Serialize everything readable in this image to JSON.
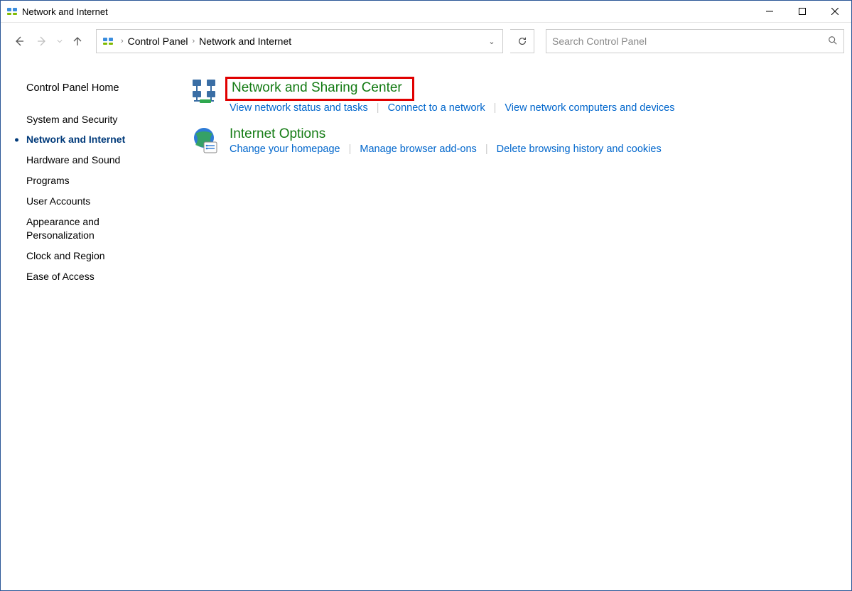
{
  "window": {
    "title": "Network and Internet"
  },
  "breadcrumb": {
    "root": "Control Panel",
    "current": "Network and Internet"
  },
  "search": {
    "placeholder": "Search Control Panel"
  },
  "sidebar": {
    "home": "Control Panel Home",
    "items": [
      {
        "label": "System and Security",
        "active": false
      },
      {
        "label": "Network and Internet",
        "active": true
      },
      {
        "label": "Hardware and Sound",
        "active": false
      },
      {
        "label": "Programs",
        "active": false
      },
      {
        "label": "User Accounts",
        "active": false
      },
      {
        "label": "Appearance and Personalization",
        "active": false
      },
      {
        "label": "Clock and Region",
        "active": false
      },
      {
        "label": "Ease of Access",
        "active": false
      }
    ]
  },
  "categories": [
    {
      "title": "Network and Sharing Center",
      "highlighted": true,
      "tasks": [
        "View network status and tasks",
        "Connect to a network",
        "View network computers and devices"
      ]
    },
    {
      "title": "Internet Options",
      "highlighted": false,
      "tasks": [
        "Change your homepage",
        "Manage browser add-ons",
        "Delete browsing history and cookies"
      ]
    }
  ]
}
